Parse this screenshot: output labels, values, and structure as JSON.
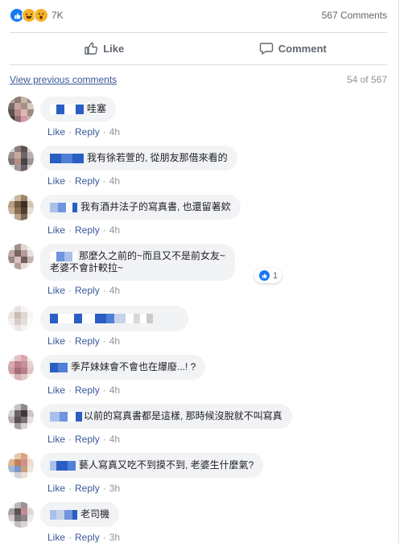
{
  "reactions": {
    "count": "7K",
    "icons": [
      "like-icon",
      "haha-icon",
      "wow-icon"
    ]
  },
  "comments_count": "567 Comments",
  "actions": {
    "like": "Like",
    "comment": "Comment"
  },
  "prev": {
    "link": "View previous comments",
    "count": "54 of 567"
  },
  "colors": {
    "link": "#385898",
    "muted": "#90949c",
    "bubble": "#f2f3f5",
    "like_blue": "#1877f2"
  },
  "comments": [
    {
      "text": "哇塞",
      "like": "Like",
      "reply": "Reply",
      "time": "4h"
    },
    {
      "text": "我有徐若萱的, 從朋友那借來看的",
      "like": "Like",
      "reply": "Reply",
      "time": "4h"
    },
    {
      "text": "我有酒井法子的寫真書, 也還留著欸",
      "like": "Like",
      "reply": "Reply",
      "time": "4h"
    },
    {
      "text_line1": "那麼久之前的~而且又不是前女友~",
      "text_line2": "老婆不會計較拉~",
      "like": "Like",
      "reply": "Reply",
      "time": "4h",
      "reaction_count": "1"
    },
    {
      "text": "",
      "like": "Like",
      "reply": "Reply",
      "time": "4h"
    },
    {
      "text": "季芹妹妹會不會也在爆廢...! ?",
      "like": "Like",
      "reply": "Reply",
      "time": "4h"
    },
    {
      "text": "以前的寫真書都是這樣, 那時候沒脫就不叫寫真",
      "like": "Like",
      "reply": "Reply",
      "time": "4h"
    },
    {
      "text": "藝人寫真又吃不到摸不到, 老婆生什麼氣?",
      "like": "Like",
      "reply": "Reply",
      "time": "3h"
    },
    {
      "text": "老司機",
      "like": "Like",
      "reply": "Reply",
      "time": "3h"
    }
  ]
}
